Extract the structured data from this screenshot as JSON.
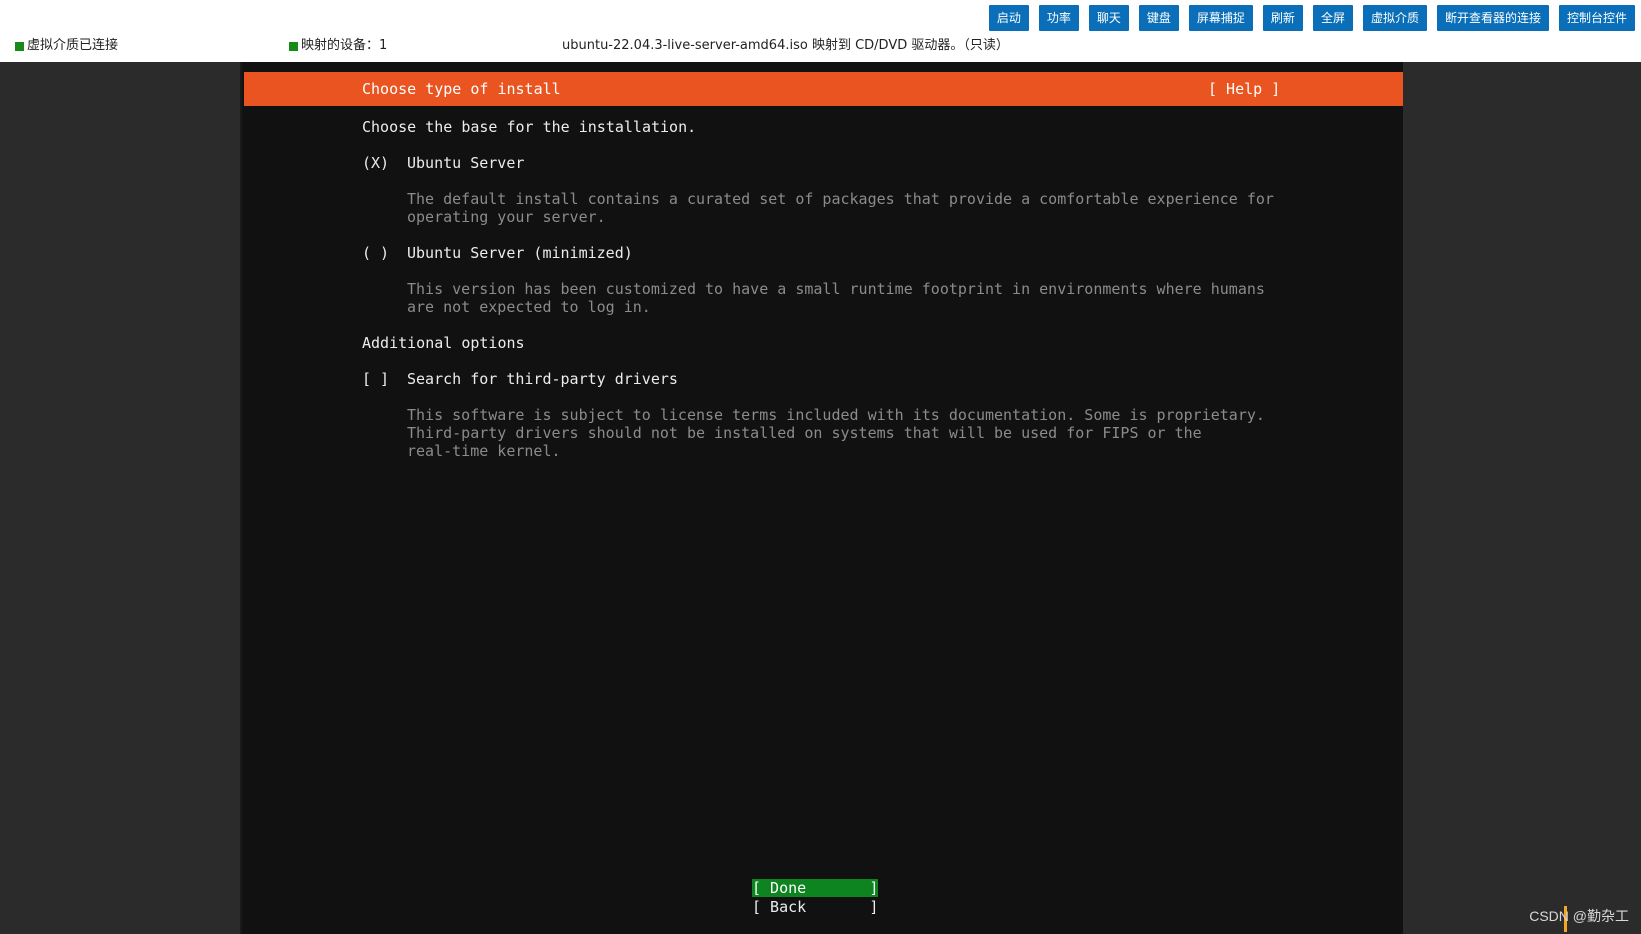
{
  "toolbar": {
    "buttons": [
      "启动",
      "功率",
      "聊天",
      "键盘",
      "屏幕捕捉",
      "刷新",
      "全屏",
      "虚拟介质",
      "断开查看器的连接",
      "控制台控件"
    ]
  },
  "status": {
    "media": "虚拟介质已连接",
    "devices": "映射的设备：1",
    "mapping": "ubuntu-22.04.3-live-server-amd64.iso 映射到 CD/DVD 驱动器。（只读）",
    "indicator_color": "#178a17"
  },
  "installer": {
    "title": "Choose type of install",
    "help": "[ Help ]",
    "prompt": "Choose the base for the installation.",
    "options": [
      {
        "marker": "(X)",
        "label": "Ubuntu Server",
        "desc": [
          "The default install contains a curated set of packages that provide a comfortable experience for",
          "operating your server."
        ]
      },
      {
        "marker": "( )",
        "label": "Ubuntu Server (minimized)",
        "desc": [
          "This version has been customized to have a small runtime footprint in environments where humans",
          "are not expected to log in."
        ]
      }
    ],
    "additional_heading": "Additional options",
    "checkbox": {
      "marker": "[ ]",
      "label": "Search for third-party drivers",
      "desc": [
        "This software is subject to license terms included with its documentation. Some is proprietary.",
        "Third-party drivers should not be installed on systems that will be used for FIPS or the",
        "real-time kernel."
      ]
    },
    "done_label": "[ Done       ]",
    "back_label": "[ Back       ]",
    "accent": "#e95420",
    "done_color": "#0e8420"
  },
  "watermark": "CSDN @勤杂工"
}
